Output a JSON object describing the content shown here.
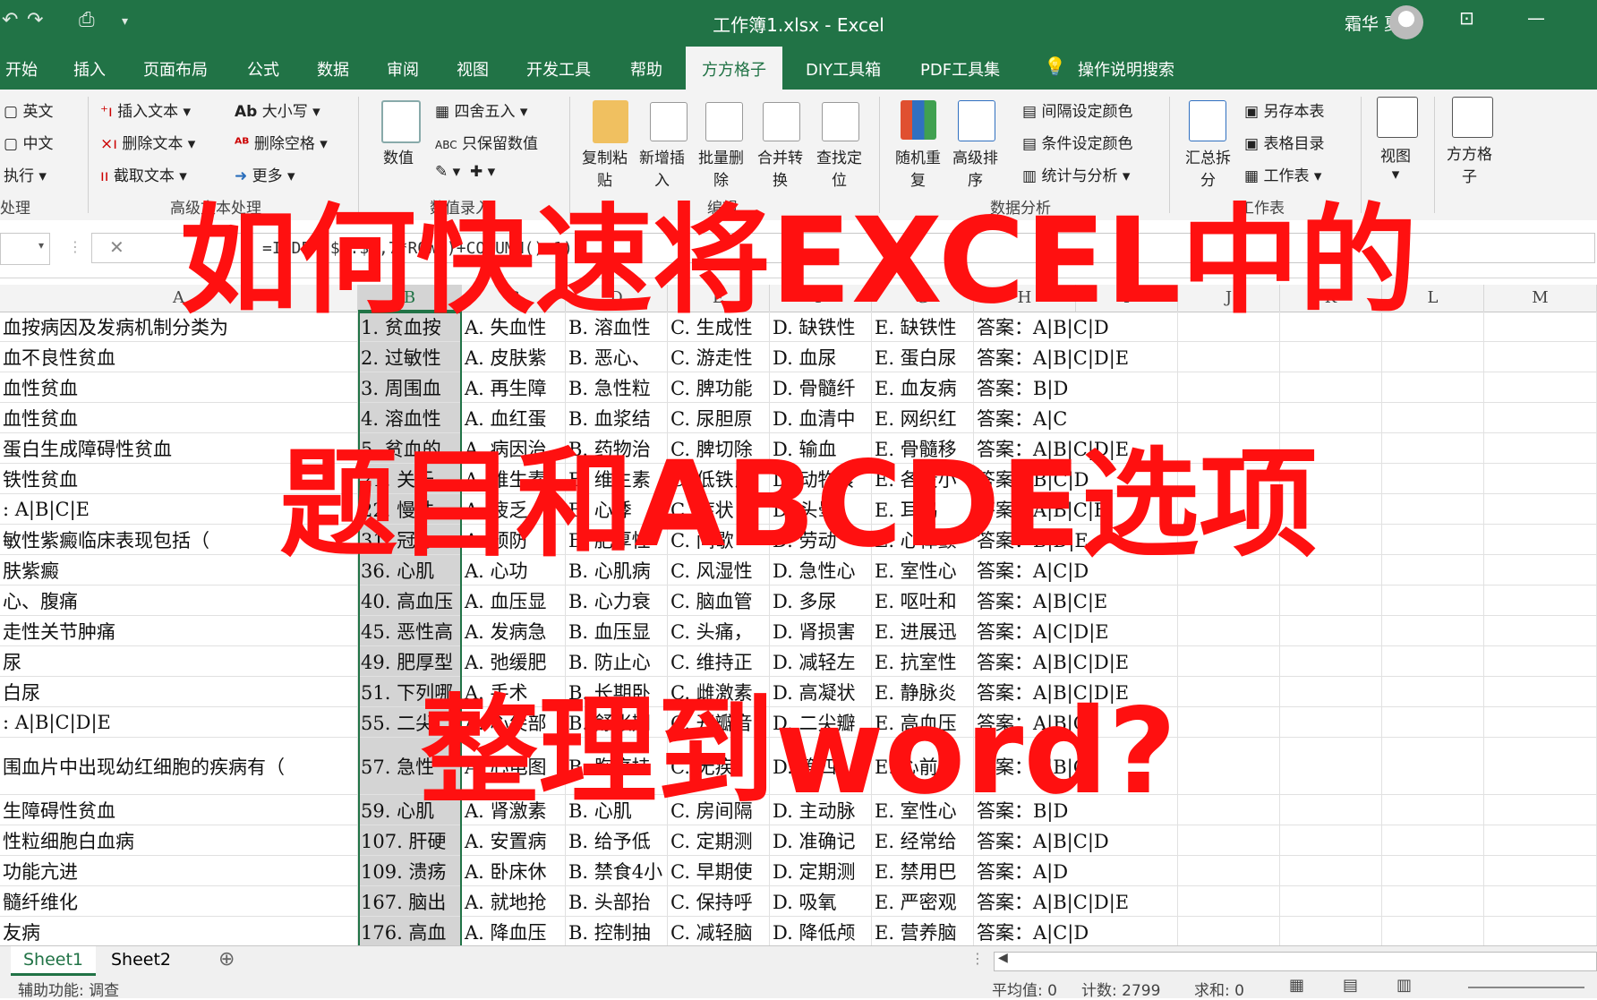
{
  "window": {
    "title": "工作簿1.xlsx  -  Excel",
    "user": "霜华 夏石",
    "icons": [
      "undo-icon",
      "redo-icon",
      "print-preview-icon",
      "customize-qat-icon",
      "ribbon-display-icon",
      "minimize-icon"
    ]
  },
  "tabs": [
    "开始",
    "插入",
    "页面布局",
    "公式",
    "数据",
    "审阅",
    "视图",
    "开发工具",
    "帮助",
    "方方格子",
    "DIY工具箱",
    "PDF工具集"
  ],
  "active_tab": "方方格子",
  "tell_me": "操作说明搜索",
  "ribbon": {
    "g1": {
      "items": [
        "英文",
        "中文",
        "执行"
      ],
      "label": "处理"
    },
    "g2": {
      "items": [
        "插入文本",
        "删除文本",
        "截取文本",
        "大小写",
        "删除空格",
        "更多"
      ],
      "label": "高级文本处理"
    },
    "g3": {
      "big": "数值",
      "items": [
        "四舍五入",
        "只保留数值"
      ],
      "label": "数值录入"
    },
    "g4": {
      "buttons": [
        "复制粘\n贴",
        "新增插\n入",
        "批量删\n除",
        "合并转\n换",
        "查找定\n位"
      ],
      "label": "编辑"
    },
    "g5": {
      "buttons": [
        "随机重\n复",
        "高级排\n序"
      ],
      "items": [
        "间隔设定颜色",
        "条件设定颜色",
        "统计与分析"
      ],
      "label": "数据分析"
    },
    "g6": {
      "big": "汇总拆\n分",
      "items": [
        "另存本表",
        "表格目录",
        "工作表"
      ],
      "label": "工作表"
    },
    "g7": {
      "big": "视图"
    },
    "g8": {
      "big": "方方格\n子"
    }
  },
  "formula": "=INDEX($A:$A,7*ROW()+COLUMN()-1)",
  "columns": [
    "A",
    "B",
    "C",
    "D",
    "E",
    "F",
    "G",
    "H",
    "I",
    "J",
    "K",
    "L",
    "M"
  ],
  "rows": [
    [
      "血按病因及发病机制分类为",
      "1. 贫血按",
      "A. 失血性",
      "B. 溶血性",
      "C. 生成性",
      "D. 缺铁性",
      "E. 缺铁性",
      "答案：A|B|C|D"
    ],
    [
      "血不良性贫血",
      "2. 过敏性",
      "A. 皮肤紫",
      "B. 恶心、",
      "C. 游走性",
      "D. 血尿",
      "E. 蛋白尿",
      "答案：A|B|C|D|E"
    ],
    [
      "血性贫血",
      "3. 周围血",
      "A. 再生障",
      "B. 急性粒",
      "C. 脾功能",
      "D. 骨髓纤",
      "E. 血友病",
      "答案：B|D"
    ],
    [
      "血性贫血",
      "4. 溶血性",
      "A. 血红蛋",
      "B. 血浆结",
      "C. 尿胆原",
      "D. 血清中",
      "E. 网织红",
      "答案：A|C"
    ],
    [
      "蛋白生成障碍性贫血",
      "5. 贫血的",
      "A. 病因治",
      "B. 药物治",
      "C. 脾切除",
      "D. 输血",
      "E. 骨髓移",
      "答案：A|B|C|D|E"
    ],
    [
      "铁性贫血",
      "21. 关于",
      "A. 维生素",
      "B. 维生素",
      "C. 低铁比",
      "D. 动物食",
      "E. 各段小",
      "答案：B|C|D"
    ],
    [
      ": A|B|C|E",
      "22. 慢性",
      "A. 疲乏",
      "B. 心悸",
      "C. 症状",
      "D. 头晕",
      "E. 耳鸣",
      "答案：A|B|C|E"
    ],
    [
      "敏性紫癜临床表现包括（",
      "31. 冠心",
      "A. 预防",
      "B. 肥厚性",
      "C. 间歇",
      "D. 劳动",
      "E. 心律颤",
      "答案：B|D|E"
    ],
    [
      "肤紫癜",
      "36. 心肌",
      "A. 心功",
      "B. 心肌病",
      "C. 风湿性",
      "D. 急性心",
      "E. 室性心",
      "答案：A|C|D"
    ],
    [
      "心、腹痛",
      "40. 高血压",
      "A. 血压显",
      "B. 心力衰",
      "C. 脑血管",
      "D. 多尿",
      "E. 呕吐和",
      "答案：A|B|C|E"
    ],
    [
      "走性关节肿痛",
      "45. 恶性高",
      "A. 发病急",
      "B. 血压显",
      "C. 头痛，",
      "D. 肾损害",
      "E. 进展迅",
      "答案：A|C|D|E"
    ],
    [
      "尿",
      "49. 肥厚型",
      "A. 弛缓肥",
      "B. 防止心",
      "C. 维持正",
      "D. 减轻左",
      "E. 抗室性",
      "答案：A|B|C|D|E"
    ],
    [
      "白尿",
      "51. 下列哪",
      "A. 手术",
      "B. 长期卧",
      "C. 雌激素",
      "D. 高凝状",
      "E. 静脉炎",
      "答案：A|B|C|D|E"
    ],
    [
      ": A|B|C|D|E",
      "55. 二尖",
      "A. 心尖部",
      "B. 舒张期",
      "C. 开瓣音",
      "D. 二尖瓣",
      "E. 高血压",
      "答案：A|B|C"
    ],
    [
      "围血片中出现幼红细胞的疾病有（",
      "57. 急性",
      "A. 心电图",
      "B. 胸痛持",
      "C. 无疾",
      "D. 第四",
      "E. 心前区",
      "答案：A|B|C"
    ],
    [
      "生障碍性贫血",
      "59. 心肌",
      "A. 肾激素",
      "B. 心肌",
      "C. 房间隔",
      "D. 主动脉",
      "E. 室性心",
      "答案：B|D"
    ],
    [
      "性粒细胞白血病",
      "107. 肝硬",
      "A. 安置病",
      "B. 给予低",
      "C. 定期测",
      "D. 准确记",
      "E. 经常给",
      "答案：A|B|C|D"
    ],
    [
      "功能亢进",
      "109. 溃疡",
      "A. 卧床休",
      "B. 禁食4小",
      "C. 早期使",
      "D. 定期测",
      "E. 禁用巴",
      "答案：A|D"
    ],
    [
      "髓纤维化",
      "167. 脑出",
      "A. 就地抢",
      "B. 头部抬",
      "C. 保持呼",
      "D. 吸氧",
      "E. 严密观",
      "答案：A|B|C|D|E"
    ],
    [
      "友病",
      "176. 高血",
      "A. 降血压",
      "B. 控制抽",
      "C. 减轻脑",
      "D. 降低颅",
      "E. 营养脑",
      "答案：A|C|D"
    ]
  ],
  "sheets": [
    "Sheet1",
    "Sheet2"
  ],
  "status": {
    "left": "辅助功能: 调查",
    "avg": "平均值: 0",
    "count": "计数: 2799",
    "sum": "求和: 0"
  },
  "overlay": {
    "line1": "如何快速将EXCEL中的",
    "line2": "题目和ABCDE选项",
    "line3": "整理到word?",
    "color": "#ff1010"
  }
}
